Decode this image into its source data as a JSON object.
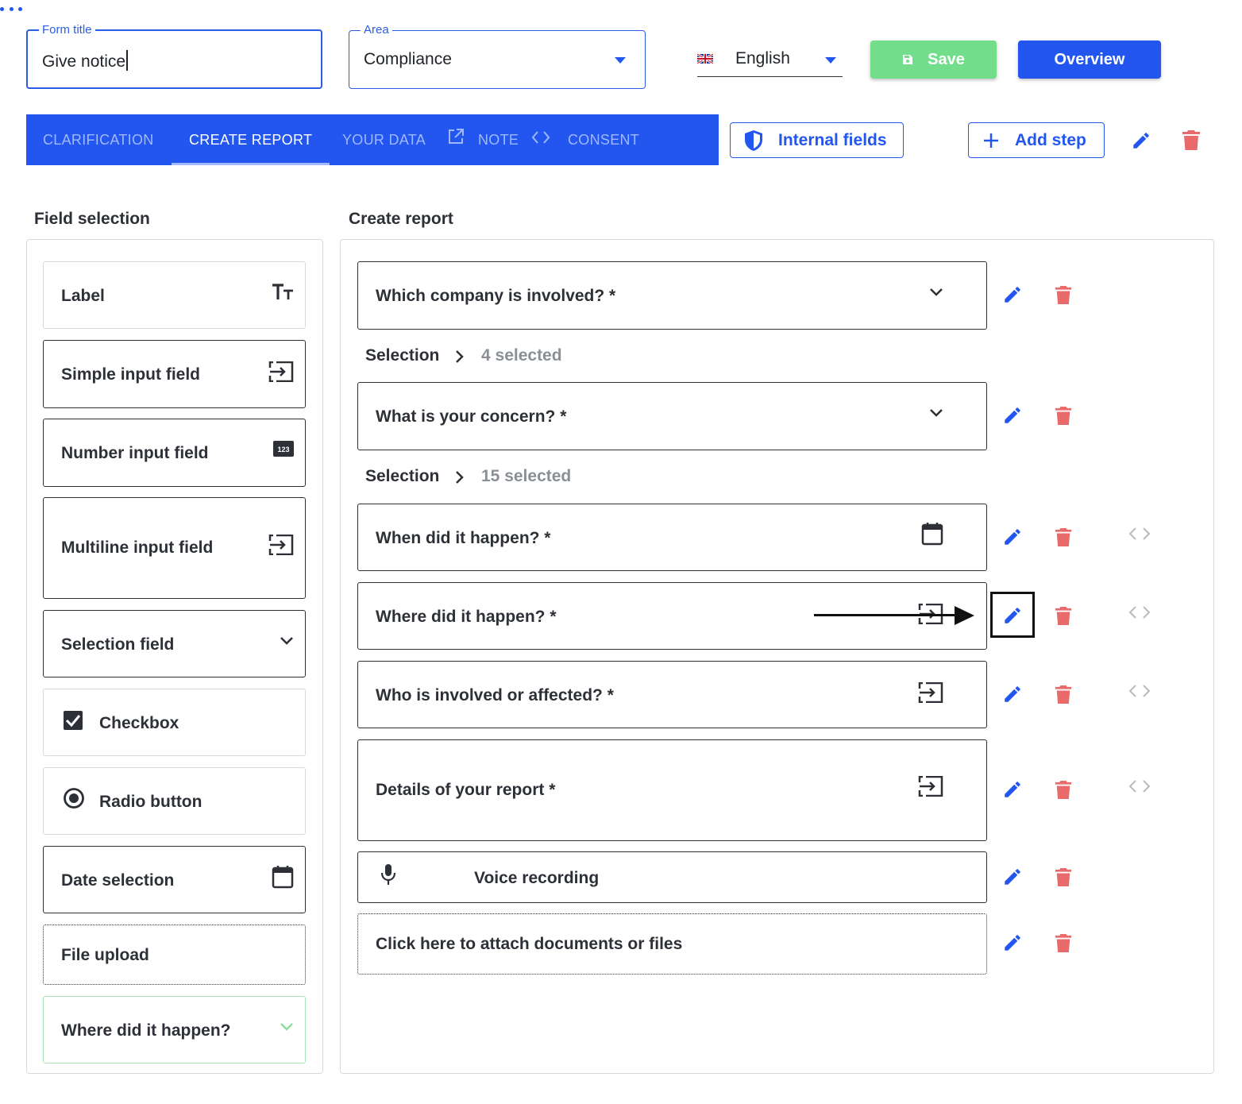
{
  "header": {
    "form_title": {
      "legend": "Form title",
      "value": "Give notice"
    },
    "area": {
      "legend": "Area",
      "value": "Compliance"
    },
    "language": {
      "label": "English",
      "flag_icon": "uk-flag-icon"
    },
    "save_label": "Save",
    "overview_label": "Overview"
  },
  "tabs": [
    {
      "label": "Clarification"
    },
    {
      "label": "Create report"
    },
    {
      "label": "Your data"
    },
    {
      "label": "Note"
    },
    {
      "label": "Consent"
    }
  ],
  "toolbar": {
    "internal_fields_label": "Internal fields",
    "add_step_label": "Add step"
  },
  "field_selection": {
    "heading": "Field selection",
    "items": [
      {
        "label": "Label",
        "icon": "text-size-icon"
      },
      {
        "label": "Simple input field",
        "icon": "input-icon"
      },
      {
        "label": "Number input field",
        "icon": "numbers-icon"
      },
      {
        "label": "Multiline input field",
        "icon": "input-icon"
      },
      {
        "label": "Selection field",
        "icon": "chevron-down-icon"
      },
      {
        "label": "Checkbox",
        "icon": "checkbox-checked-icon"
      },
      {
        "label": "Radio button",
        "icon": "radio-selected-icon"
      },
      {
        "label": "Date selection",
        "icon": "calendar-icon"
      },
      {
        "label": "File upload"
      },
      {
        "label": "Where did it happen?",
        "icon": "chevron-down-icon"
      }
    ]
  },
  "create_report": {
    "heading": "Create report",
    "fields": [
      {
        "label": "Which company is involved? *",
        "icon": "chevron-down-icon",
        "selection_label": "Selection",
        "selection_count": "4 selected"
      },
      {
        "label": "What is your concern? *",
        "icon": "chevron-down-icon",
        "selection_label": "Selection",
        "selection_count": "15 selected"
      },
      {
        "label": "When did it happen? *",
        "icon": "calendar-icon"
      },
      {
        "label": "Where did it happen? *",
        "icon": "input-icon"
      },
      {
        "label": "Who is involved or affected? *",
        "icon": "input-icon"
      },
      {
        "label": "Details of your report *",
        "icon": "input-icon"
      },
      {
        "label": "Voice recording",
        "icon": "microphone-icon"
      },
      {
        "label": "Click here to attach documents or files"
      }
    ]
  },
  "colors": {
    "primary": "#2356ef",
    "danger": "#e86a6a",
    "success": "#72dd8b"
  }
}
